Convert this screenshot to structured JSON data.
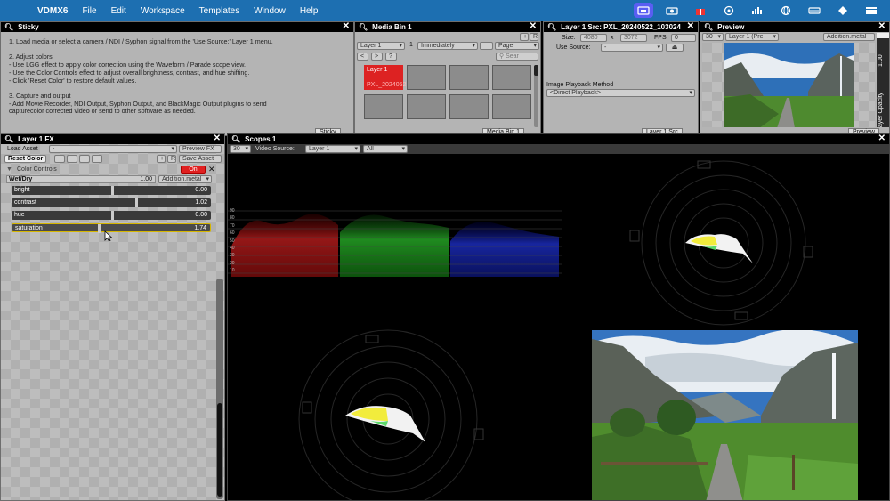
{
  "menubar": {
    "app_name": "VDMX6",
    "items": [
      "File",
      "Edit",
      "Workspace",
      "Templates",
      "Window",
      "Help"
    ]
  },
  "sticky": {
    "title": "Sticky",
    "lines": [
      "1. Load media or select a camera / NDI / Syphon signal from the 'Use Source:' Layer 1 menu.",
      "",
      "2. Adjust colors",
      "- Use LGG effect to apply color correction using the Waveform / Parade scope view.",
      "- Use the Color Controls effect to adjust overall brightness, contrast, and hue shifting.",
      "- Click 'Reset Color' to restore default values.",
      "",
      "3. Capture and output",
      "- Add Movie Recorder, NDI Output, Syphon Output, and BlackMagic Output plugins to send",
      "capturecolor corrected video or send to other software as needed."
    ],
    "footer_tab": "Sticky"
  },
  "media_bin": {
    "title": "Media Bin 1",
    "layer_select": "Layer 1",
    "num_label": "1",
    "playback_select": "Immediately",
    "page_select": "Page",
    "plus": "+",
    "r": "R",
    "prev": "<",
    "next": ">",
    "help": "?",
    "search_placeholder": "Sear",
    "clip_label_top": "Layer 1",
    "clip_label_bottom": "PXL_2024052",
    "footer_tab": "Media Bin 1"
  },
  "layer_src": {
    "title": "Layer 1 Src: PXL_20240522_103024",
    "size_label": "Size:",
    "width": "4080",
    "x": "x",
    "height": "3072",
    "fps_label": "FPS:",
    "fps_value": "0",
    "use_source_label": "Use Source:",
    "use_source_value": "-",
    "eject": "⏏",
    "image_playback_label": "Image Playback Method",
    "image_playback_value": "<Direct Playback>",
    "footer_tab": "Layer 1 Src"
  },
  "preview": {
    "title": "Preview",
    "fps": "30",
    "layer_select": "Layer 1 (Pre",
    "blend_select": "Addition.metal",
    "opacity_value": "1.00",
    "opacity_label": "Layer Opacity",
    "footer_tab": "Preview"
  },
  "fx": {
    "title": "Layer 1 FX",
    "load_asset": "Load Asset",
    "load_asset_value": "-",
    "preview_fx": "Preview FX",
    "plus": "+",
    "r": "R",
    "save_asset": "Save Asset",
    "reset_color": "Reset Color",
    "color_controls": "Color Controls",
    "on": "On",
    "wet_dry_label": "Wet/Dry",
    "wet_dry_value": "1.00",
    "blend_select": "Addition.metal",
    "sliders": [
      {
        "name": "bright",
        "value": "0.00"
      },
      {
        "name": "contrast",
        "value": "1.02"
      },
      {
        "name": "hue",
        "value": "0.00"
      },
      {
        "name": "saturation",
        "value": "1.74"
      }
    ],
    "slider_levels": [
      0.5,
      0.62,
      0.5,
      0.43
    ]
  },
  "scopes": {
    "title": "Scopes 1",
    "fps": "30",
    "video_source_label": "Video Source:",
    "video_source_value": "Layer 1",
    "all_select": "All",
    "axis_ticks": [
      "90",
      "80",
      "70",
      "60",
      "50",
      "40",
      "30",
      "20",
      "10"
    ]
  },
  "colors": {
    "menubar": "#1d6fb1",
    "active_clip": "#dd2222",
    "on_button": "#e02020",
    "selected_slider": "#d6b600"
  }
}
